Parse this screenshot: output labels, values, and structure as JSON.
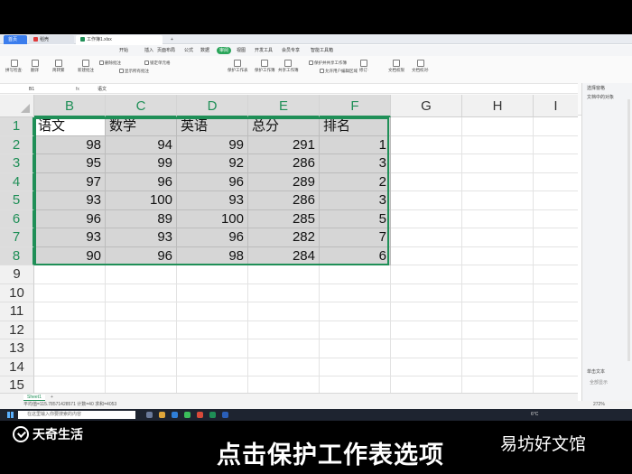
{
  "tabs": {
    "home": "首页",
    "wps": "稻壳",
    "workbook": "工作簿1.xlsx",
    "add": "+"
  },
  "menu": [
    "开始",
    "插入",
    "页面布局",
    "公式",
    "数据",
    "审阅",
    "视图",
    "开发工具",
    "会员专享",
    "智能工具箱"
  ],
  "menu_active_index": 5,
  "ribbon": [
    {
      "label": "拼写检查·",
      "icon": "spellcheck-icon"
    },
    {
      "label": "翻译",
      "icon": "translate-icon"
    },
    {
      "label": "简转繁",
      "icon": "simplified-traditional-icon"
    },
    {
      "label": "新建批注",
      "icon": "new-comment-icon"
    },
    {
      "label": "删除批注",
      "icon": "delete-comment-icon"
    },
    {
      "label": "显示所有批注",
      "icon": "show-comments-icon"
    },
    {
      "label": "锁定单元格",
      "icon": "lock-cell-icon"
    },
    {
      "label": "保护工作表",
      "icon": "protect-sheet-icon"
    },
    {
      "label": "保护工作簿",
      "icon": "protect-workbook-icon"
    },
    {
      "label": "共享工作簿",
      "icon": "share-workbook-icon"
    },
    {
      "label": "保护并共享工作簿",
      "icon": "protect-share-icon"
    },
    {
      "label": "允许用户编辑区域",
      "icon": "allow-edit-icon"
    },
    {
      "label": "修订·",
      "icon": "revision-icon"
    },
    {
      "label": "文档权限",
      "icon": "doc-permission-icon"
    },
    {
      "label": "文档校对·",
      "icon": "proofread-icon"
    }
  ],
  "formula_bar": {
    "cell_ref": "B1",
    "fx": "fx",
    "content": "语文"
  },
  "right_panel": {
    "title": "选择窗格",
    "item": "文档中的对象",
    "bottom": "单击文本",
    "bottom2": "全部显示"
  },
  "columns": [
    "B",
    "C",
    "D",
    "E",
    "F",
    "G",
    "H",
    "I"
  ],
  "rows": [
    "1",
    "2",
    "3",
    "4",
    "5",
    "6",
    "7",
    "8",
    "9",
    "10",
    "11",
    "12",
    "13",
    "14",
    "15"
  ],
  "table": {
    "headers": [
      "语文",
      "数学",
      "英语",
      "总分",
      "排名"
    ],
    "data": [
      [
        "98",
        "94",
        "99",
        "291",
        "1"
      ],
      [
        "95",
        "99",
        "92",
        "286",
        "3"
      ],
      [
        "97",
        "96",
        "96",
        "289",
        "2"
      ],
      [
        "93",
        "100",
        "93",
        "286",
        "3"
      ],
      [
        "96",
        "89",
        "100",
        "285",
        "5"
      ],
      [
        "93",
        "93",
        "96",
        "282",
        "7"
      ],
      [
        "90",
        "96",
        "98",
        "284",
        "6"
      ]
    ]
  },
  "sheet_tab": "Sheet1",
  "sheet_add": "+",
  "status": {
    "summary": "平均值=115.78571428571 计数=40 求和=4053",
    "zoom": "272%"
  },
  "taskbar": {
    "search_placeholder": "在这里输入你要搜索的内容",
    "weather": "6°C"
  },
  "overlay": {
    "logo": "天奇生活",
    "caption": "点击保护工作表选项",
    "watermark": "易坊好文馆"
  },
  "colors": {
    "accent": "#1f8f57",
    "tab_active": "#3b7ded",
    "selection_fill": "#d6d6d6"
  }
}
